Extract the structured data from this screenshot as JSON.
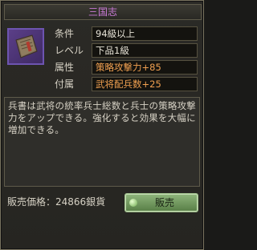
{
  "title": "三国志",
  "item": {
    "icon": "book-icon"
  },
  "props": [
    {
      "label": "条件",
      "value": "94級以上",
      "color": "white"
    },
    {
      "label": "レベル",
      "value": "下品1級",
      "color": "white"
    },
    {
      "label": "属性",
      "value": "策略攻撃力+85",
      "color": "orange"
    },
    {
      "label": "付属",
      "value": "武将配兵数+25",
      "color": "orange"
    }
  ],
  "description": "兵書は武将の統率兵士総数と兵士の策略攻撃力をアップできる。強化すると効果を大幅に増加できる。",
  "sale": {
    "label": "販売価格：24866銀貨",
    "button_label": "販売"
  }
}
